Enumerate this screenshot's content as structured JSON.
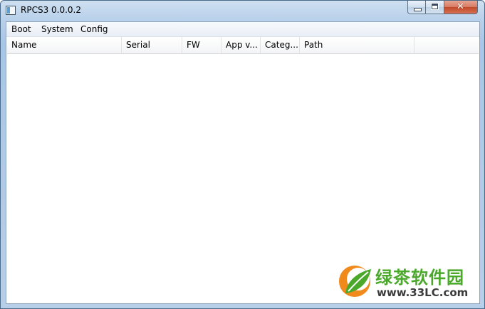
{
  "window": {
    "title": "RPCS3 0.0.0.2",
    "close_glyph": "✕"
  },
  "menubar": {
    "items": [
      "Boot",
      "System",
      "Config"
    ]
  },
  "game_list": {
    "columns": [
      "Name",
      "Serial",
      "FW",
      "App v...",
      "Categ...",
      "Path"
    ],
    "rows": []
  },
  "watermark": {
    "name": "绿茶软件园",
    "url": "www.33LC.com"
  },
  "colors": {
    "watermark_green": "#4aa82a",
    "watermark_orange": "#f08a1c",
    "close_button": "#c14a2c"
  }
}
